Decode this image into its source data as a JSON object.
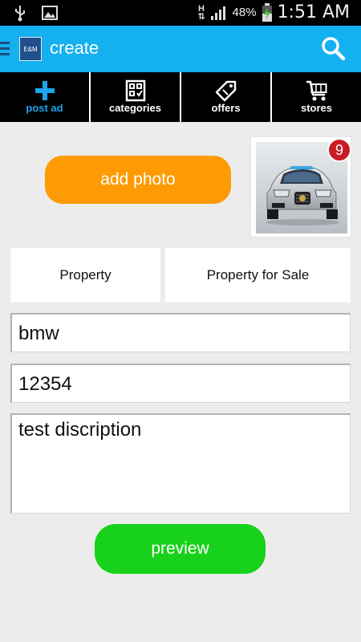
{
  "status_bar": {
    "time": "1:51 AM",
    "battery_pct": "48%",
    "network_type": "H",
    "icons": [
      "usb-icon",
      "image-notification-icon",
      "signal-icon",
      "battery-charging-icon"
    ]
  },
  "app_bar": {
    "title": "create",
    "logo_text": "E&M"
  },
  "tabs": [
    {
      "label": "post ad",
      "icon": "plus-icon",
      "active": true
    },
    {
      "label": "categories",
      "icon": "categories-icon",
      "active": false
    },
    {
      "label": "offers",
      "icon": "tag-icon",
      "active": false
    },
    {
      "label": "stores",
      "icon": "cart-icon",
      "active": false
    }
  ],
  "photo": {
    "add_label": "add photo",
    "count": "9"
  },
  "category": {
    "main": "Property",
    "sub": "Property for Sale"
  },
  "form": {
    "title_value": "bmw",
    "price_value": "12354",
    "description_value": "test discription"
  },
  "actions": {
    "preview_label": "preview"
  },
  "colors": {
    "app_bar": "#14b0ef",
    "add_photo": "#fe9b04",
    "preview": "#18d11a",
    "badge": "#c81d25",
    "active_tab": "#1ca4ee"
  }
}
